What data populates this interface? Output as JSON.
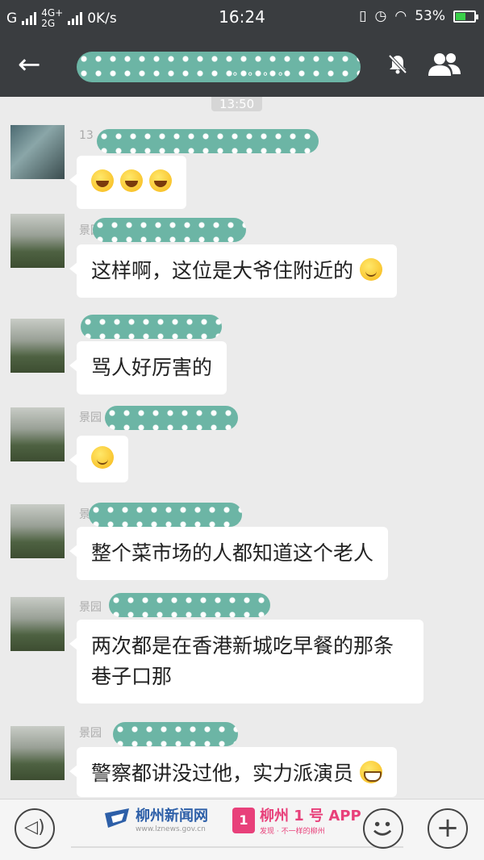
{
  "status_bar": {
    "carrier_1": "G",
    "network_1": "4G+",
    "network_2": "2G",
    "speed": "0K/s",
    "time": "16:24",
    "battery_percent": "53%",
    "battery_level": 0.53
  },
  "header": {
    "back_icon": "back-arrow-icon",
    "mute_icon": "bell-muted-icon",
    "members_icon": "group-members-icon"
  },
  "timestamp": "13:50",
  "messages": [
    {
      "sender_prefix": "13",
      "text": "",
      "emojis": [
        "laugh",
        "laugh",
        "laugh"
      ]
    },
    {
      "sender_prefix": "景园",
      "text": "这样啊，这位是大爷住附近的",
      "emojis": [
        "smile"
      ]
    },
    {
      "sender_prefix": "",
      "text": "骂人好厉害的",
      "emojis": []
    },
    {
      "sender_prefix": "景园",
      "text": "",
      "emojis": [
        "smile"
      ]
    },
    {
      "sender_prefix": "景园",
      "text": "整个菜市场的人都知道这个老人",
      "emojis": []
    },
    {
      "sender_prefix": "景园",
      "text": "两次都是在香港新城吃早餐的那条巷子口那",
      "emojis": []
    },
    {
      "sender_prefix": "景园",
      "text": "警察都讲没过他，实力派演员",
      "emojis": [
        "grin"
      ]
    }
  ],
  "bottom_bar": {
    "voice_icon": "voice-input-icon",
    "emoji_icon": "emoji-face-icon",
    "plus_icon": "plus-icon",
    "watermark_left_title": "柳州新闻网",
    "watermark_left_url": "www.lznews.gov.cn",
    "watermark_right_title": "柳州 1 号 APP",
    "watermark_right_sub": "发现 · 不一样的柳州"
  },
  "colors": {
    "bar_bg": "#3a3d40",
    "chat_bg": "#ebebeb",
    "mosaic": "#6cb5a5",
    "watermark_blue": "#2d5fa8",
    "watermark_pink": "#e8407a"
  }
}
